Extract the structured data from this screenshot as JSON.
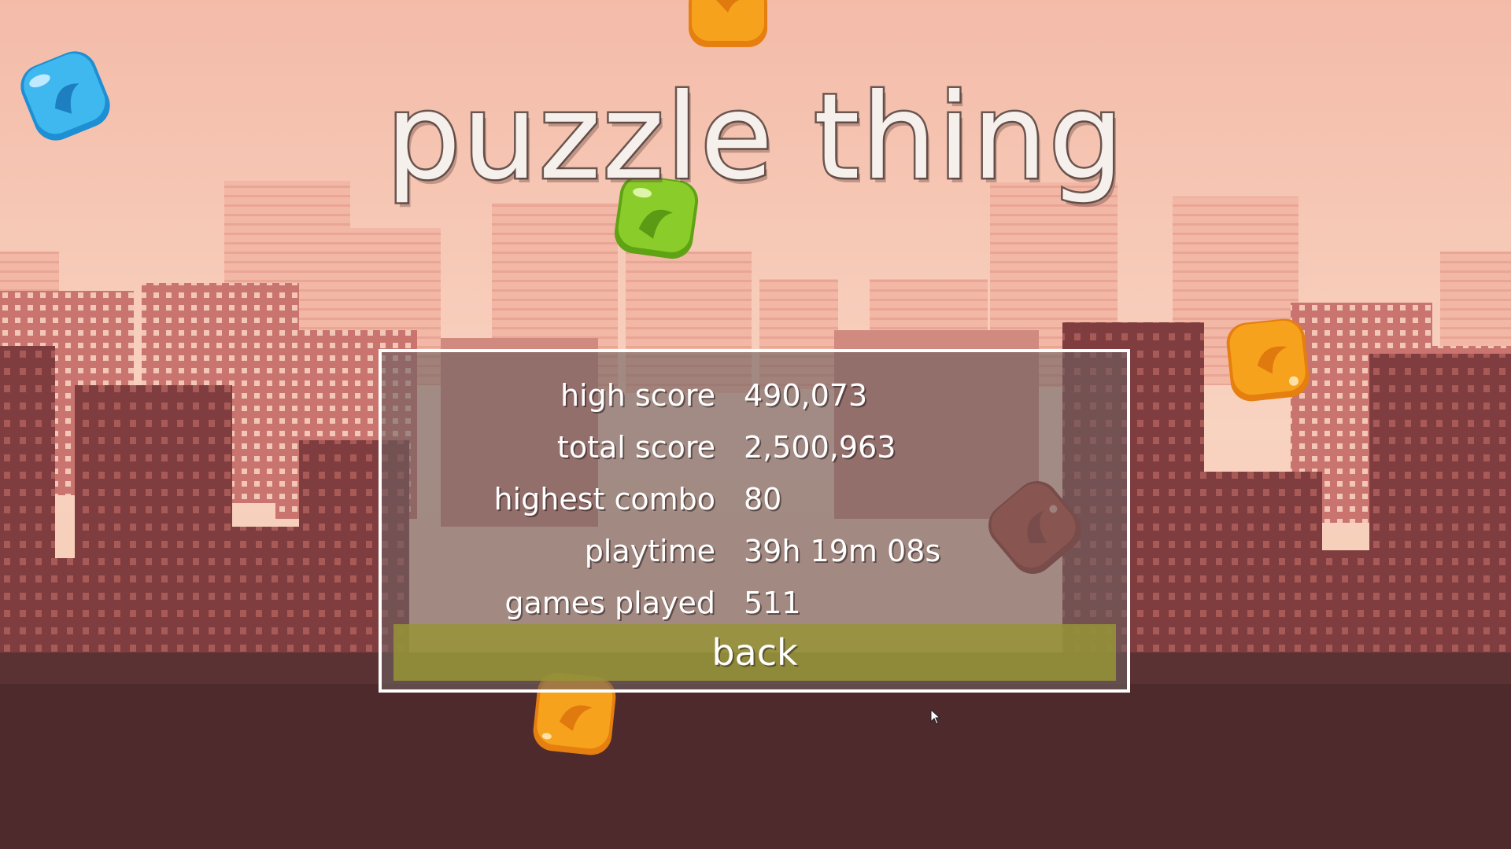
{
  "title": "puzzle thing",
  "stats": [
    {
      "label": "high score",
      "value": "490,073"
    },
    {
      "label": "total score",
      "value": "2,500,963"
    },
    {
      "label": "highest combo",
      "value": "80"
    },
    {
      "label": "playtime",
      "value": "39h 19m 08s"
    },
    {
      "label": "games played",
      "value": "511"
    }
  ],
  "back_label": "back",
  "colors": {
    "sky_top": "#f4bfae",
    "sky_bottom": "#f8d6c2",
    "ground": "#4e2a2c",
    "button": "#969437"
  },
  "gems": [
    {
      "name": "blue-gem",
      "color": "#3fb8ef"
    },
    {
      "name": "orange-gem-top",
      "color": "#f6a21c"
    },
    {
      "name": "green-gem",
      "color": "#8acd2a"
    },
    {
      "name": "orange-gem-right",
      "color": "#f6a21c"
    },
    {
      "name": "red-gem",
      "color": "#b4443a"
    },
    {
      "name": "orange-gem-bottom",
      "color": "#f6a21c"
    }
  ]
}
